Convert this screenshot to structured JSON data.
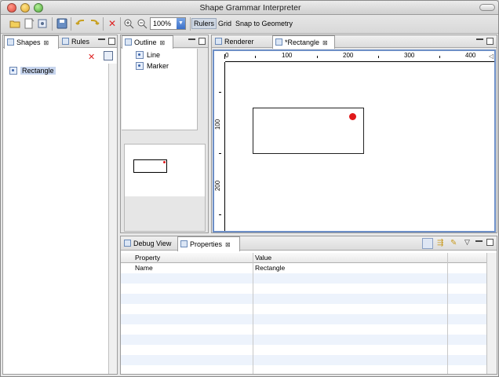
{
  "window": {
    "title": "Shape Grammar Interpreter"
  },
  "toolbar": {
    "zoom_value": "100%",
    "rulers_label": "Rulers",
    "grid_label": "Grid",
    "snap_label": "Snap to Geometry"
  },
  "shapes_view": {
    "tabs": [
      {
        "label": "Shapes",
        "close": "⊠"
      },
      {
        "label": "Rules",
        "close": ""
      }
    ],
    "items": [
      {
        "label": "Rectangle"
      }
    ]
  },
  "outline_view": {
    "tab": {
      "label": "Outline",
      "close": "⊠"
    },
    "items": [
      {
        "label": "Line"
      },
      {
        "label": "Marker"
      }
    ]
  },
  "editor": {
    "tabs": [
      {
        "label": "Renderer",
        "close": ""
      },
      {
        "label": "*Rectangle",
        "close": "⊠"
      }
    ],
    "ruler_h_labels": [
      "0",
      "100",
      "200",
      "300",
      "400"
    ],
    "ruler_v_labels": [
      "100",
      "200"
    ],
    "marker_color": "#e0181a"
  },
  "bottom_view": {
    "tabs": [
      {
        "label": "Debug View",
        "close": ""
      },
      {
        "label": "Properties",
        "close": "⊠"
      }
    ],
    "columns": [
      "Property",
      "Value"
    ],
    "rows": [
      {
        "property": "Name",
        "value": "Rectangle"
      }
    ]
  },
  "colors": {
    "accent": "#3a6fc8",
    "row_alt": "#edf3fc",
    "selection": "#c7d5ee"
  }
}
